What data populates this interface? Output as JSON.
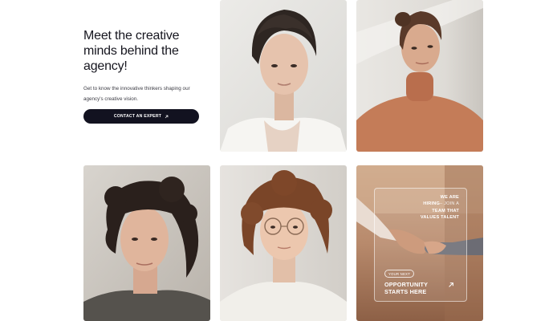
{
  "hero": {
    "headline": "Meet the creative minds behind the agency!",
    "description": "Get to know the innovative thinkers shaping our agency's creative vision.",
    "cta_label": "CONTACT AN EXPERT",
    "cta_icon": "arrow-up-right-icon"
  },
  "hiring_card": {
    "we_are": "WE ARE",
    "hiring": "HIRING",
    "join_a": "– JOIN A",
    "team_that": "TEAM THAT",
    "values_talent": "VALUES TALENT",
    "badge": "YOUR NEXT",
    "headline": "OPPORTUNITY STARTS HERE",
    "icon": "arrow-up-right-icon"
  },
  "colors": {
    "cta_background": "#121220",
    "page_background": "#ffffff",
    "hiring_card_tone": "#b4876a"
  }
}
